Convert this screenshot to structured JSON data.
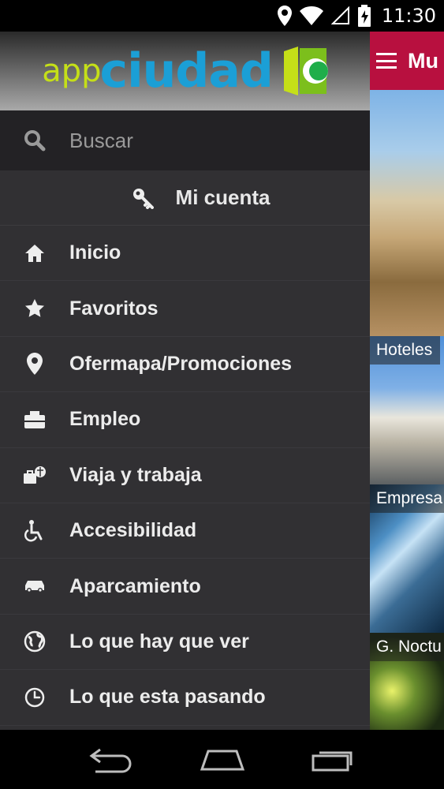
{
  "status_bar": {
    "time": "11:30"
  },
  "app_bar": {
    "title": "Mu"
  },
  "tiles": [
    {
      "label": ""
    },
    {
      "label": "Hoteles"
    },
    {
      "label": "Empresa"
    },
    {
      "label": "G. Noctu"
    }
  ],
  "drawer": {
    "logo": {
      "app": "app",
      "ciudad": "ciudad"
    },
    "search": {
      "placeholder": "Buscar",
      "value": ""
    },
    "account_label": "Mi cuenta",
    "items": [
      {
        "label": "Inicio",
        "icon": "home-icon"
      },
      {
        "label": "Favoritos",
        "icon": "star-icon"
      },
      {
        "label": "Ofermapa/Promociones",
        "icon": "map-pin-icon"
      },
      {
        "label": "Empleo",
        "icon": "briefcase-icon"
      },
      {
        "label": "Viaja y trabaja",
        "icon": "travel-work-icon"
      },
      {
        "label": "Accesibilidad",
        "icon": "wheelchair-icon"
      },
      {
        "label": "Aparcamiento",
        "icon": "car-icon"
      },
      {
        "label": "Lo que hay que ver",
        "icon": "globe-icon"
      },
      {
        "label": "Lo que esta pasando",
        "icon": "clock-icon"
      }
    ]
  },
  "colors": {
    "app_bar": "#b8103f",
    "drawer_bg": "#313033",
    "search_bg": "#232225",
    "logo_green": "#c5df18",
    "logo_blue": "#1b9fd6"
  }
}
